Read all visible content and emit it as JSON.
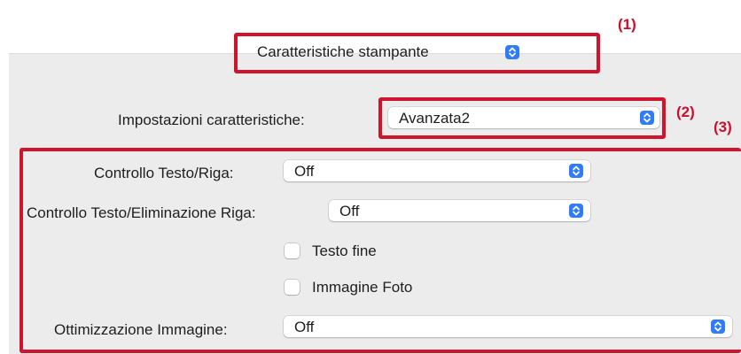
{
  "callouts": {
    "one": "(1)",
    "two": "(2)",
    "three": "(3)"
  },
  "pane_menu": {
    "value": "Caratteristiche stampante"
  },
  "features": {
    "label": "Impostazioni caratteristiche:",
    "value": "Avanzata2"
  },
  "text_line_control": {
    "label": "Controllo Testo/Riga:",
    "value": "Off"
  },
  "text_line_elimination": {
    "label": "Controllo Testo/Eliminazione Riga:",
    "value": "Off"
  },
  "fine_text": {
    "label": "Testo fine",
    "checked": false
  },
  "photo_image": {
    "label": "Immagine Foto",
    "checked": false
  },
  "image_optimization": {
    "label": "Ottimizzazione Immagine:",
    "value": "Off"
  },
  "colors": {
    "accent": "#2f7cf6",
    "highlight": "#d0142c"
  },
  "icons": {
    "stepper": "chevron-updown-icon"
  }
}
